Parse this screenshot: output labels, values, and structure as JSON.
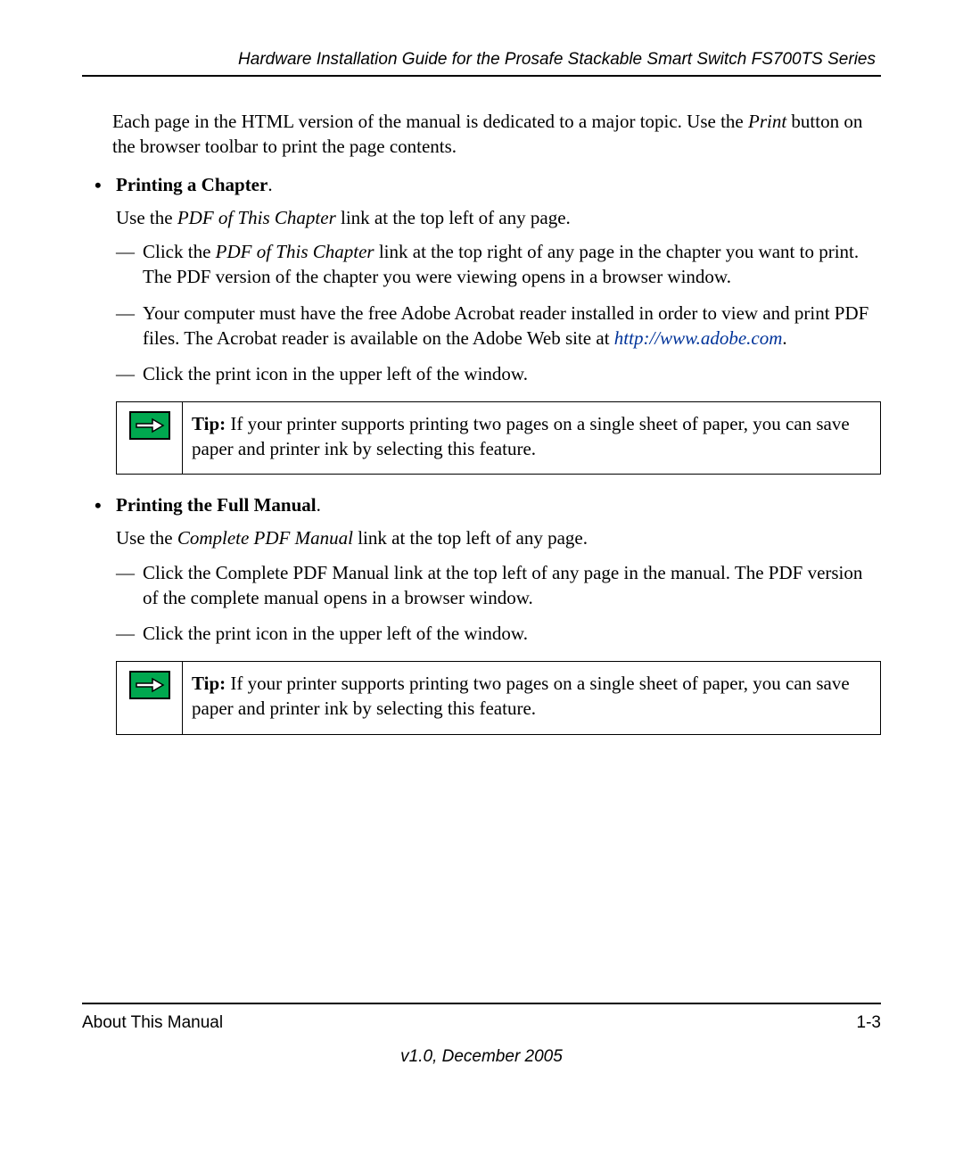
{
  "header": {
    "title": "Hardware Installation Guide for the Prosafe Stackable Smart Switch FS700TS Series"
  },
  "intro": {
    "prefix": "Each page in the HTML version of the manual is dedicated to a major topic. Use the ",
    "italic": "Print",
    "suffix": " button on the browser toolbar to print the page contents."
  },
  "sections": [
    {
      "heading": "Printing a Chapter",
      "period": ".",
      "sub": {
        "prefix": "Use the ",
        "italic": "PDF of This Chapter",
        "suffix": " link at the top left of any page."
      },
      "dashes": [
        {
          "prefix": "Click the ",
          "italic": "PDF of This Chapter",
          "suffix": " link at the top right of any page in the chapter you want to print. The PDF version of the chapter you were viewing opens in a browser window."
        },
        {
          "text": "Your computer must have the free Adobe Acrobat reader installed in order to view and print PDF files. The Acrobat reader is available on the Adobe Web site at ",
          "link": "http://www.adobe.com",
          "after_link": "."
        },
        {
          "plain": "Click the print icon in the upper left of the window."
        }
      ],
      "tip": {
        "label": "Tip:",
        "text": " If your printer supports printing two pages on a single sheet of paper, you can save paper and printer ink by selecting this feature."
      }
    },
    {
      "heading": "Printing the Full Manual",
      "period": ".",
      "sub": {
        "prefix": "Use the ",
        "italic": "Complete PDF Manual",
        "suffix": " link at the top left of any page."
      },
      "dashes": [
        {
          "plain": "Click the Complete PDF Manual link at the top left of any page in the manual. The PDF version of the complete manual opens in a browser window."
        },
        {
          "plain": "Click the print icon in the upper left of the window."
        }
      ],
      "tip": {
        "label": "Tip:",
        "text": " If your printer supports printing two pages on a single sheet of paper, you can save paper and printer ink by selecting this feature."
      }
    }
  ],
  "footer": {
    "left": "About This Manual",
    "right": "1-3",
    "version": "v1.0, December 2005"
  }
}
